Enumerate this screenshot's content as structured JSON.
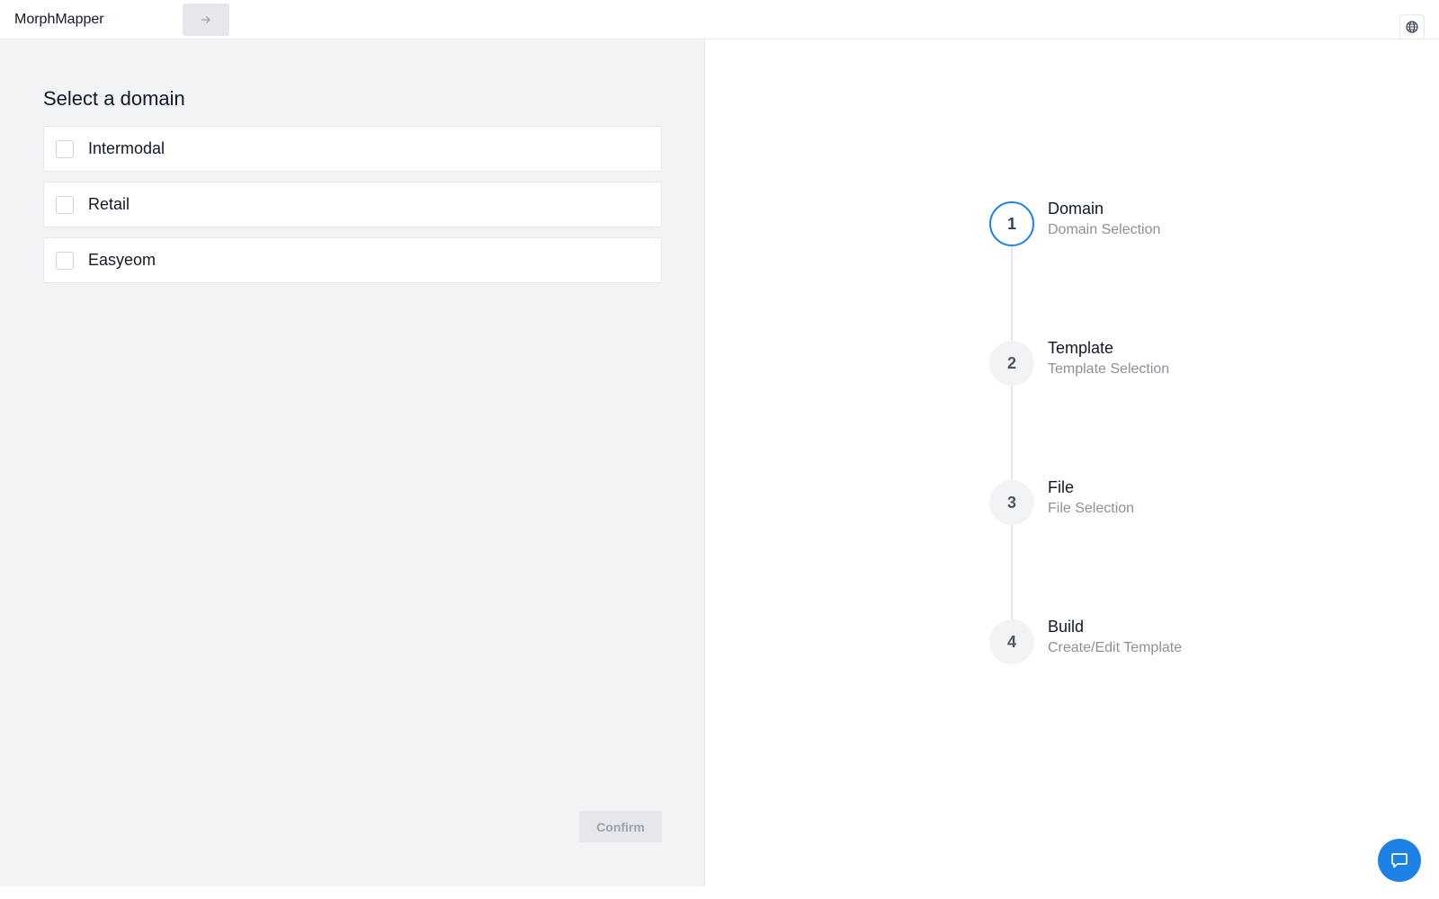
{
  "app": {
    "title": "MorphMapper"
  },
  "header": {
    "next_icon": "arrow-right-icon",
    "language_icon": "globe-icon"
  },
  "domain_panel": {
    "heading": "Select a domain",
    "options": [
      {
        "label": "Intermodal",
        "checked": false
      },
      {
        "label": "Retail",
        "checked": false
      },
      {
        "label": "Easyeom",
        "checked": false
      }
    ],
    "confirm_label": "Confirm"
  },
  "stepper": {
    "active_color": "#1d81e6",
    "steps": [
      {
        "number": "1",
        "title": "Domain",
        "subtitle": "Domain Selection",
        "active": true
      },
      {
        "number": "2",
        "title": "Template",
        "subtitle": "Template Selection",
        "active": false
      },
      {
        "number": "3",
        "title": "File",
        "subtitle": "File Selection",
        "active": false
      },
      {
        "number": "4",
        "title": "Build",
        "subtitle": "Create/Edit Template",
        "active": false
      }
    ]
  },
  "chat": {
    "icon": "chat-bubble-icon",
    "color": "#1d81e6"
  }
}
